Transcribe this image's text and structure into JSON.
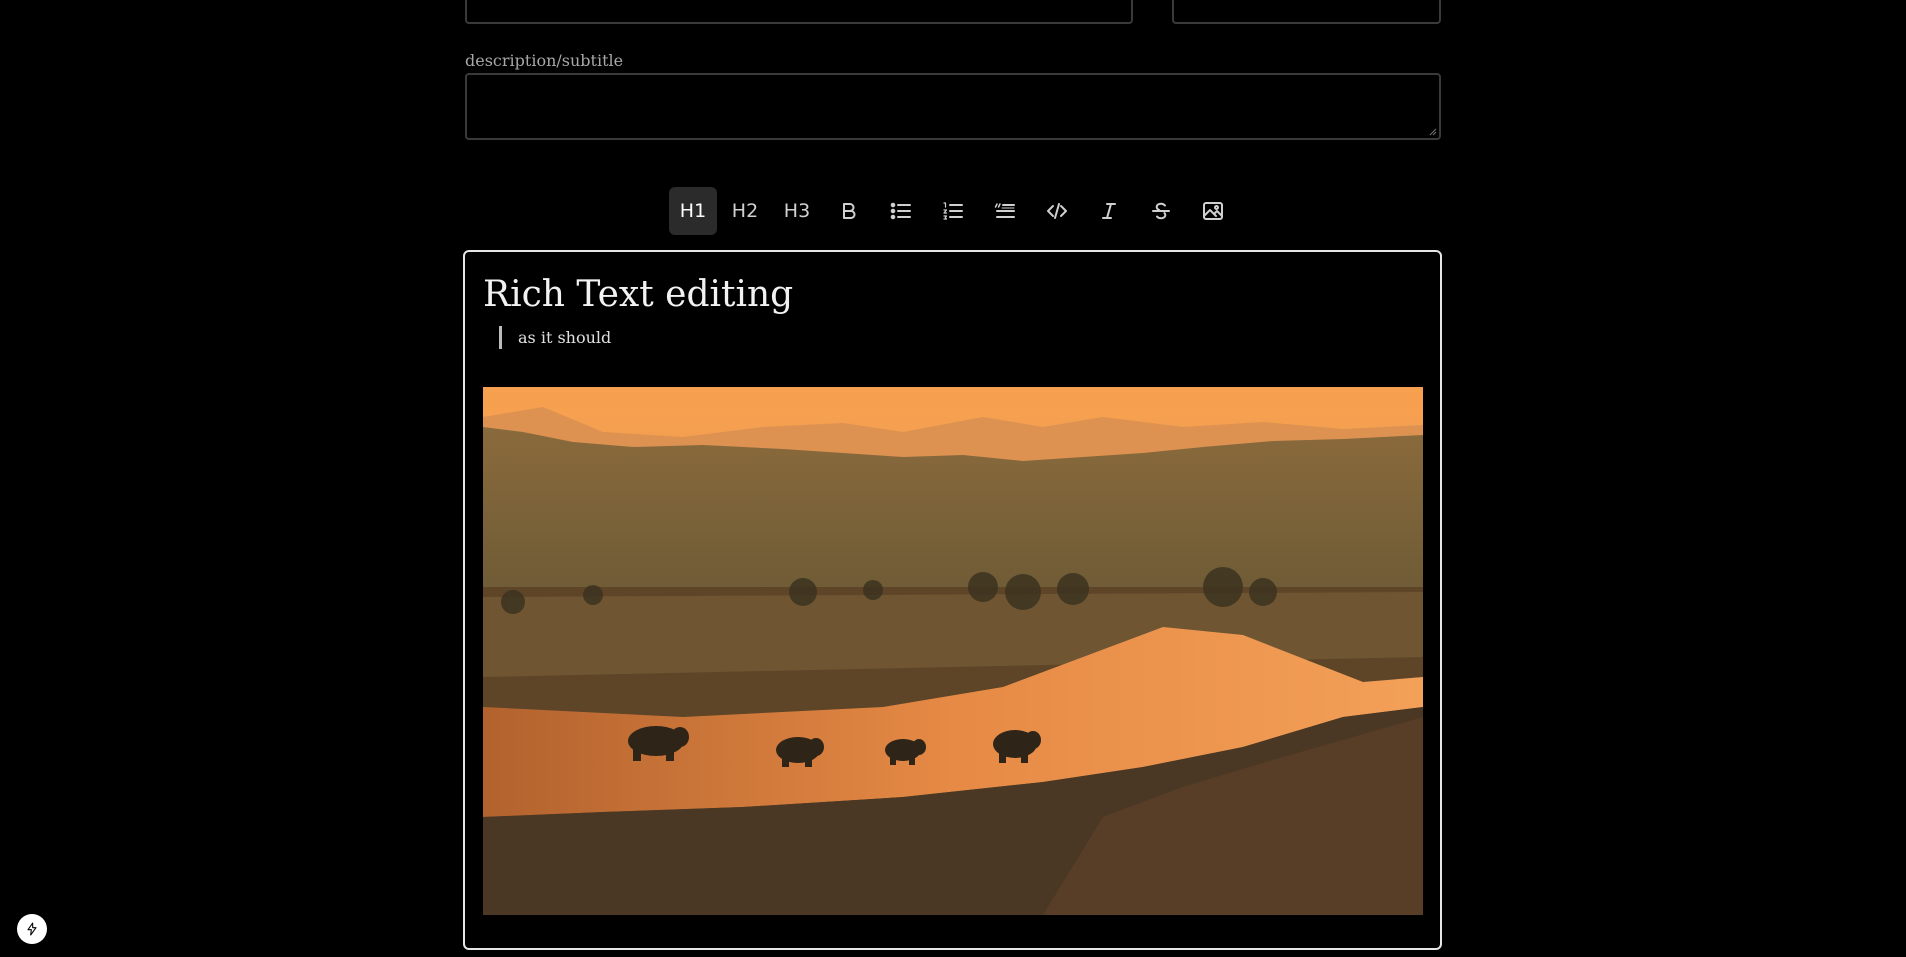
{
  "form": {
    "description_label": "description/subtitle",
    "description_value": ""
  },
  "toolbar": {
    "buttons": [
      {
        "label": "H1",
        "icon": "heading-1",
        "active": true
      },
      {
        "label": "H2",
        "icon": "heading-2",
        "active": false
      },
      {
        "label": "H3",
        "icon": "heading-3",
        "active": false
      },
      {
        "label": "",
        "icon": "bold-icon",
        "active": false
      },
      {
        "label": "",
        "icon": "bullet-list-icon",
        "active": false
      },
      {
        "label": "",
        "icon": "ordered-list-icon",
        "active": false
      },
      {
        "label": "",
        "icon": "blockquote-icon",
        "active": false
      },
      {
        "label": "",
        "icon": "code-icon",
        "active": false
      },
      {
        "label": "",
        "icon": "italic-icon",
        "active": false
      },
      {
        "label": "",
        "icon": "strikethrough-icon",
        "active": false
      },
      {
        "label": "",
        "icon": "image-icon",
        "active": false
      }
    ]
  },
  "editor": {
    "heading": "Rich Text editing",
    "blockquote": "as it should",
    "image": {
      "subject": "elephants crossing river at sunset"
    }
  },
  "corner_badge": {
    "icon": "lightning-bolt-icon"
  },
  "colors": {
    "background": "#000000",
    "field_border": "#3a3a3a",
    "editor_border": "#e6e6e6",
    "active_button_bg": "#2b2b2b"
  }
}
